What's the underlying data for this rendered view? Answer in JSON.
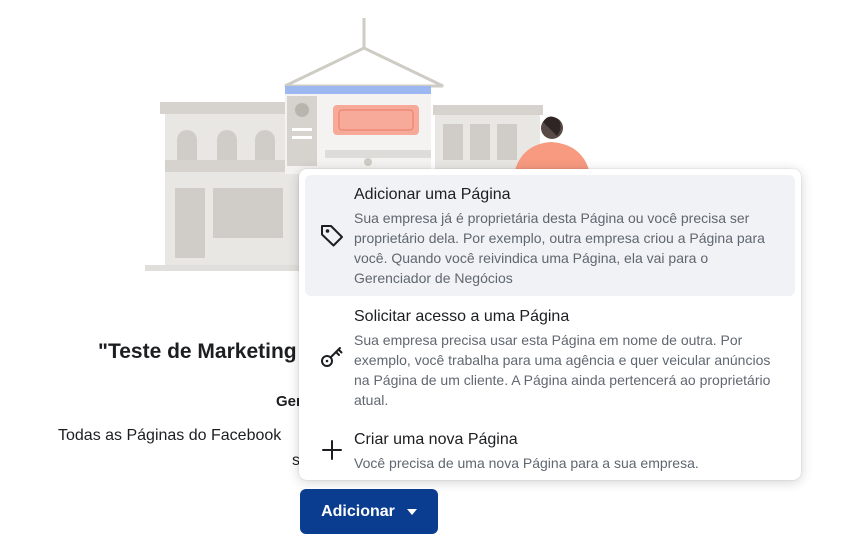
{
  "background": {
    "title": "\"Teste de Marketing",
    "subtitle": "Ger",
    "description_1": "Todas as Páginas do Facebook",
    "description_2": "s"
  },
  "add_button": {
    "label": "Adicionar",
    "icon": "caret-down-icon"
  },
  "menu": {
    "items": [
      {
        "icon": "tag-icon",
        "title": "Adicionar uma Página",
        "description": "Sua empresa já é proprietária desta Página ou você precisa ser proprietário dela. Por exemplo, outra empresa criou a Página para você. Quando você reivindica uma Página, ela vai para o Gerenciador de Negócios"
      },
      {
        "icon": "key-icon",
        "title": "Solicitar acesso a uma Página",
        "description": "Sua empresa precisa usar esta Página em nome de outra. Por exemplo, você trabalha para uma agência e quer veicular anúncios na Página de um cliente. A Página ainda pertencerá ao proprietário atual."
      },
      {
        "icon": "plus-icon",
        "title": "Criar uma nova Página",
        "description": "Você precisa de uma nova Página para a sua empresa."
      }
    ]
  },
  "colors": {
    "button_bg": "#0a3d8f",
    "hover_bg": "#f0f2f5",
    "text_primary": "#1c1e21",
    "text_secondary": "#606770"
  }
}
